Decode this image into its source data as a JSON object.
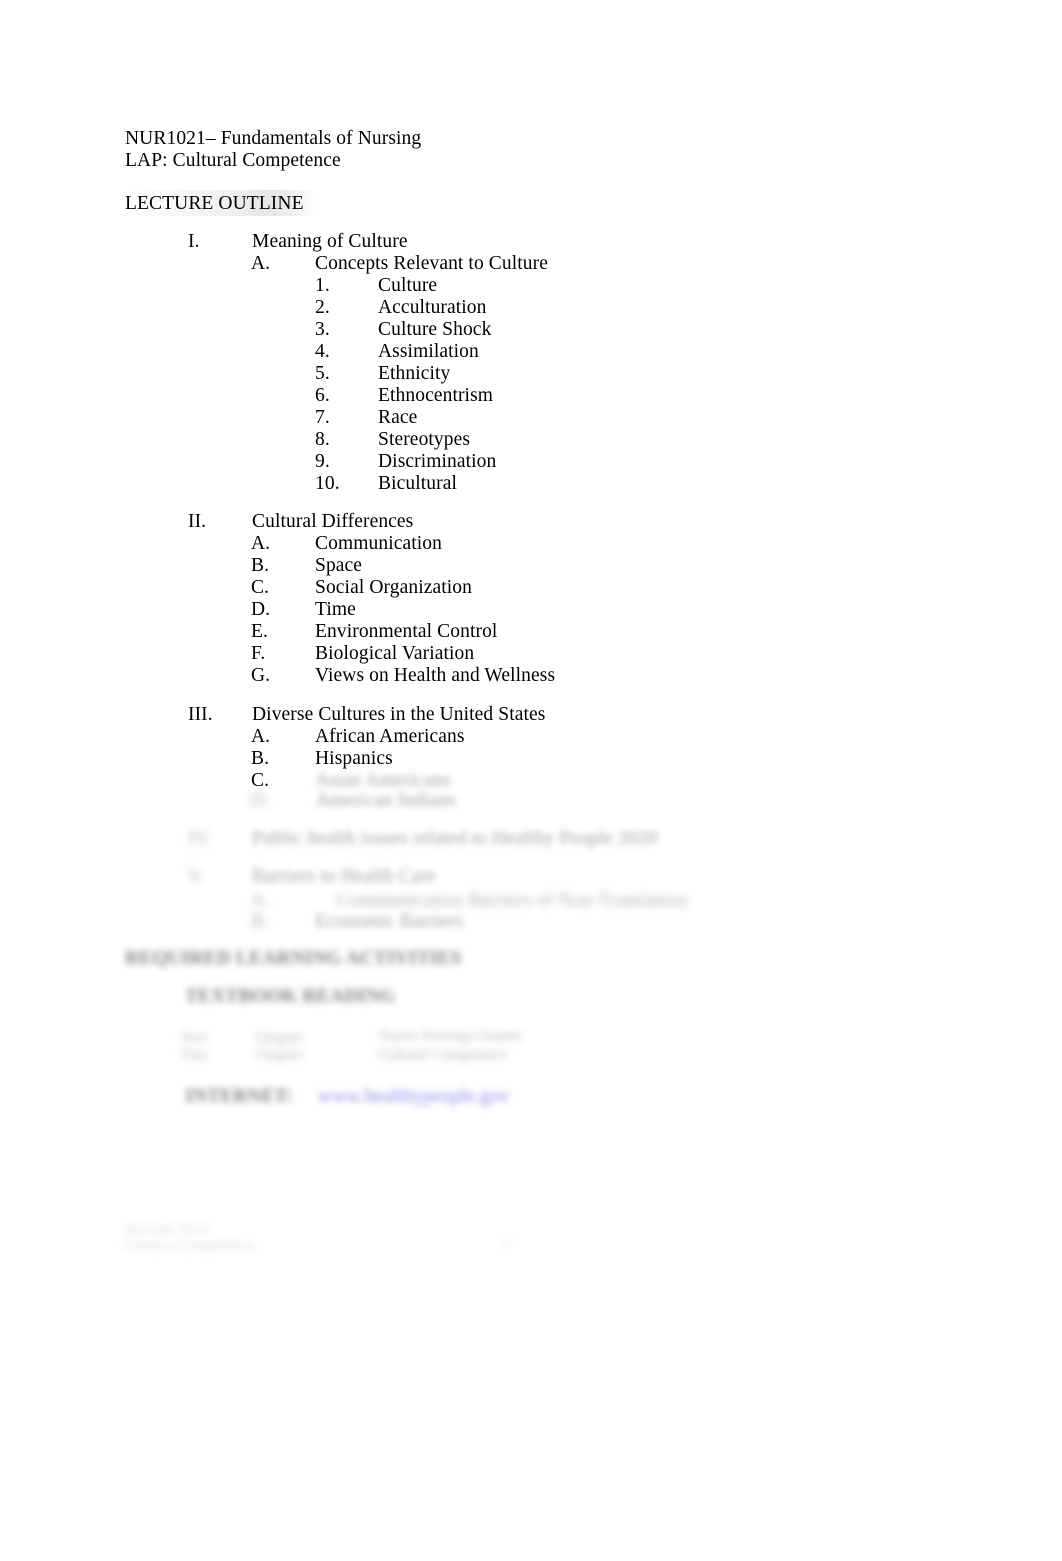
{
  "document": {
    "course_line": "NUR1021– Fundamentals of Nursing",
    "lap_line": "LAP: Cultural Competence",
    "section_heading": "LECTURE OUTLINE"
  },
  "outline": {
    "sections": [
      {
        "numeral": "I.",
        "title": "Meaning of Culture",
        "subsections": [
          {
            "letter": "A.",
            "title": "Concepts Relevant to Culture",
            "items": [
              {
                "num": "1.",
                "label": "Culture"
              },
              {
                "num": "2.",
                "label": "Acculturation"
              },
              {
                "num": "3.",
                "label": "Culture Shock"
              },
              {
                "num": "4.",
                "label": "Assimilation"
              },
              {
                "num": "5.",
                "label": "Ethnicity"
              },
              {
                "num": "6.",
                "label": "Ethnocentrism"
              },
              {
                "num": "7.",
                "label": "Race"
              },
              {
                "num": "8.",
                "label": "Stereotypes"
              },
              {
                "num": "9.",
                "label": "Discrimination"
              },
              {
                "num": "10.",
                "label": "Bicultural"
              }
            ]
          }
        ]
      },
      {
        "numeral": "II.",
        "title": "Cultural Differences",
        "subsections": [
          {
            "letter": "A.",
            "title": "Communication"
          },
          {
            "letter": "B.",
            "title": "Space"
          },
          {
            "letter": "C.",
            "title": "Social Organization"
          },
          {
            "letter": "D.",
            "title": "Time"
          },
          {
            "letter": "E.",
            "title": "Environmental Control"
          },
          {
            "letter": "F.",
            "title": "Biological Variation"
          },
          {
            "letter": "G.",
            "title": "Views on Health and Wellness"
          }
        ]
      },
      {
        "numeral": "III.",
        "title": "Diverse Cultures in the United States",
        "subsections": [
          {
            "letter": "A.",
            "title": "African Americans"
          },
          {
            "letter": "B.",
            "title": "Hispanics"
          },
          {
            "letter": "C.",
            "title": ""
          }
        ]
      }
    ]
  },
  "redacted": {
    "note": "Lower portion of the page is blurred and illegible; placeholder glyph runs approximate the obscured text blocks.",
    "section3_item_c_text": "Asian Americans",
    "section3_item_d_marker": "D.",
    "section3_item_d_text": "American Indians",
    "section4_marker": "IV.",
    "section4_text": "Public health issues related to Healthy People 2020",
    "section5_marker": "V.",
    "section5_text": "Barriers to Health Care",
    "section5_item_a_marker": "A.",
    "section5_item_a_text": "Communication Barriers of Non-Translation",
    "section5_item_b_marker": "B.",
    "section5_item_b_text": "Economic Barriers",
    "heading_learning_activities": "REQUIRED LEARNING ACTIVITIES",
    "heading_textbook_reading": "TEXTBOOK READING",
    "reading_col1_row1": "Text",
    "reading_col1_row2": "Text",
    "reading_col2_row1": "Chapter",
    "reading_col2_row2": "Chapter",
    "reading_col3_row1": "Taylor Nursing Chapter",
    "reading_col3_row2": "Cultural Competence",
    "internet_label": "INTERNET:",
    "internet_link": "www.healthypeople.gov",
    "footer_line1": "Revised 2014",
    "footer_line2": "Cultural Competence",
    "footer_page": "1"
  }
}
